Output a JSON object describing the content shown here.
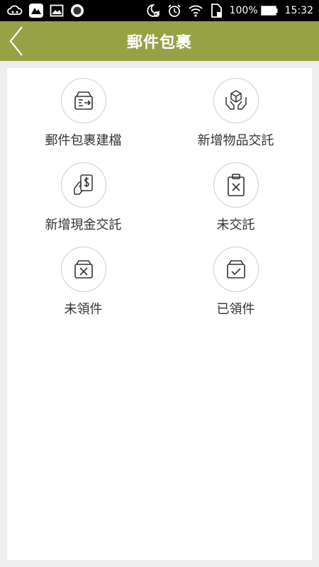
{
  "status_bar": {
    "battery_percent": "100%",
    "time": "15:32",
    "icons": [
      "cloud-link-icon",
      "app-logo-icon",
      "image-icon",
      "record-icon",
      "moon-alarm-icon",
      "alarm-clock-icon",
      "wifi-icon",
      "sim-card-icon",
      "battery-icon"
    ]
  },
  "header": {
    "title": "郵件包裹",
    "back_icon": "chevron-left-icon",
    "background_color": "#97a247"
  },
  "menu": {
    "items": [
      {
        "label": "郵件包裹建檔",
        "icon": "inbox-arrow-icon"
      },
      {
        "label": "新增物品交託",
        "icon": "hands-box-icon"
      },
      {
        "label": "新增現金交託",
        "icon": "cash-hand-icon"
      },
      {
        "label": "未交託",
        "icon": "clipboard-x-icon"
      },
      {
        "label": "未領件",
        "icon": "tray-x-icon"
      },
      {
        "label": "已領件",
        "icon": "tray-check-icon"
      }
    ]
  }
}
